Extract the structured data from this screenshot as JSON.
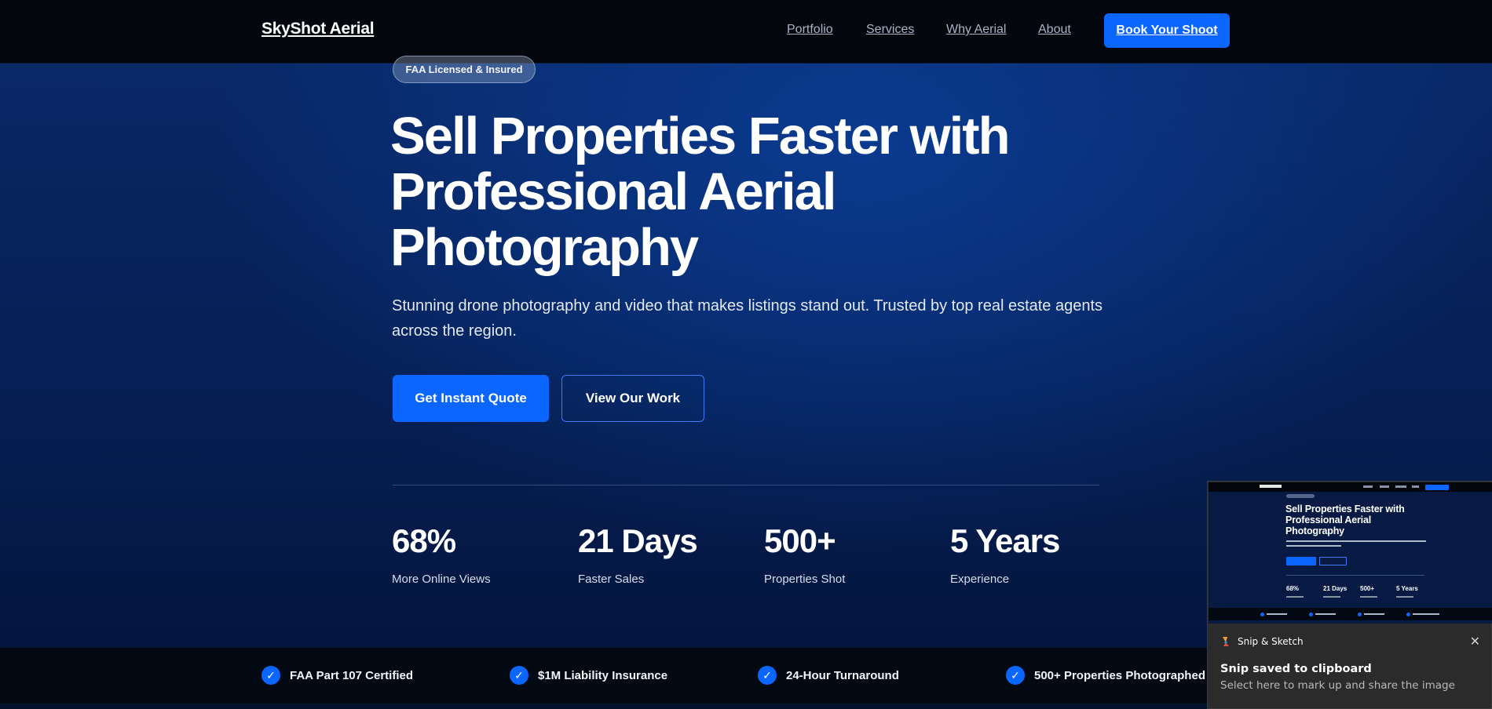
{
  "nav": {
    "logo": "SkyShot Aerial",
    "links": [
      "Portfolio",
      "Services",
      "Why Aerial",
      "About"
    ],
    "cta": "Book Your Shoot"
  },
  "hero": {
    "badge": "FAA Licensed & Insured",
    "headline": "Sell Properties Faster with Professional Aerial Photography",
    "subtitle": "Stunning drone photography and video that makes listings stand out. Trusted by top real estate agents across the region.",
    "primary_button": "Get Instant Quote",
    "secondary_button": "View Our Work"
  },
  "stats": [
    {
      "value": "68%",
      "label": "More Online Views"
    },
    {
      "value": "21 Days",
      "label": "Faster Sales"
    },
    {
      "value": "500+",
      "label": "Properties Shot"
    },
    {
      "value": "5 Years",
      "label": "Experience"
    }
  ],
  "trust": [
    {
      "icon": "check-icon",
      "label": "FAA Part 107 Certified"
    },
    {
      "icon": "check-icon",
      "label": "$1M Liability Insurance"
    },
    {
      "icon": "check-icon",
      "label": "24-Hour Turnaround"
    },
    {
      "icon": "check-icon",
      "label": "500+ Properties Photographed"
    }
  ],
  "toast": {
    "app_name": "Snip & Sketch",
    "heading": "Snip saved to clipboard",
    "body": "Select here to mark up and share the image",
    "close_icon": "close-icon",
    "thumb_headline": "Sell Properties Faster with Professional Aerial Photography",
    "thumb_stats": [
      "68%",
      "21 Days",
      "500+",
      "5 Years"
    ]
  },
  "colors": {
    "accent": "#0a66ff",
    "nav_bg": "#03060c",
    "hero_bg": "#062056"
  }
}
